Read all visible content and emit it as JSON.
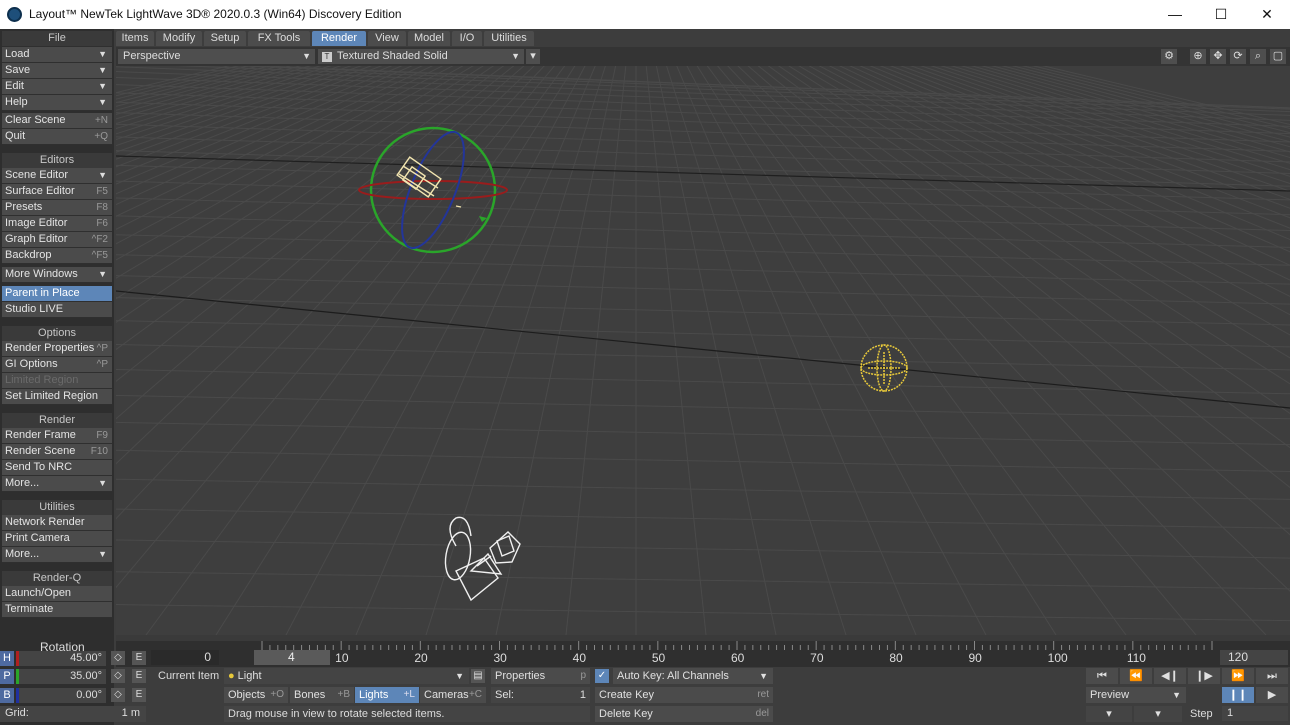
{
  "window": {
    "title": "Layout™ NewTek LightWave 3D® 2020.0.3 (Win64) Discovery Edition",
    "minimize": "—",
    "maximize": "☐",
    "close": "✕"
  },
  "sidebar": {
    "file_header": "File",
    "load": "Load",
    "save": "Save",
    "edit": "Edit",
    "help": "Help",
    "clear_scene": "Clear Scene",
    "clear_scene_sc": "+N",
    "quit": "Quit",
    "quit_sc": "+Q",
    "editors_header": "Editors",
    "scene_editor": "Scene Editor",
    "surface_editor": "Surface Editor",
    "surface_editor_sc": "F5",
    "presets": "Presets",
    "presets_sc": "F8",
    "image_editor": "Image Editor",
    "image_editor_sc": "F6",
    "graph_editor": "Graph Editor",
    "graph_editor_sc": "^F2",
    "backdrop": "Backdrop",
    "backdrop_sc": "^F5",
    "more_windows": "More Windows",
    "parent_in_place": "Parent in Place",
    "studio_live": "Studio LIVE",
    "options_header": "Options",
    "render_properties": "Render Properties",
    "render_properties_sc": "^P",
    "gi_options": "GI Options",
    "gi_options_sc": "^P",
    "limited_region": "Limited Region",
    "set_limited_region": "Set Limited Region",
    "render_header": "Render",
    "render_frame": "Render Frame",
    "render_frame_sc": "F9",
    "render_scene": "Render Scene",
    "render_scene_sc": "F10",
    "send_to_nrc": "Send To NRC",
    "more1": "More...",
    "utilities_header": "Utilities",
    "network_render": "Network Render",
    "print_camera": "Print Camera",
    "more2": "More...",
    "renderq_header": "Render-Q",
    "launch_open": "Launch/Open",
    "terminate": "Terminate"
  },
  "tabs": [
    "Items",
    "Modify",
    "Setup",
    "FX Tools",
    "Render",
    "View",
    "Model",
    "I/O",
    "Utilities"
  ],
  "viewport": {
    "view_mode": "Perspective",
    "shading_mode": "Textured Shaded Solid"
  },
  "timeline": {
    "ticks": [
      "0",
      "10",
      "20",
      "30",
      "40",
      "50",
      "60",
      "70",
      "80",
      "90",
      "100",
      "110",
      "120"
    ],
    "current_frame": "4",
    "start": "0",
    "end": "120"
  },
  "transform": {
    "header": "Rotation",
    "h_label": "H",
    "h_value": "45.00°",
    "p_label": "P",
    "p_value": "35.00°",
    "b_label": "B",
    "b_value": "0.00°",
    "e": "E",
    "grid_label": "Grid:",
    "grid_value": "1 m"
  },
  "bottom": {
    "current_item_label": "Current Item",
    "current_item": "Light",
    "properties": "Properties",
    "properties_sc": "p",
    "objects": "Objects",
    "objects_sc": "+O",
    "bones": "Bones",
    "bones_sc": "+B",
    "lights": "Lights",
    "lights_sc": "+L",
    "cameras": "Cameras",
    "cameras_sc": "+C",
    "sel_label": "Sel:",
    "sel_value": "1",
    "status": "Drag mouse in view to rotate selected items.",
    "auto_key": "Auto Key: All Channels",
    "create_key": "Create Key",
    "create_key_sc": "ret",
    "delete_key": "Delete Key",
    "delete_key_sc": "del",
    "preview": "Preview",
    "step_label": "Step",
    "step_value": "1"
  },
  "colors": {
    "accent": "#5d86b8",
    "light_gizmo": "#e8c93a",
    "rotate_h": "#2aa52a",
    "rotate_p": "#b02020",
    "rotate_b": "#2030a0"
  }
}
